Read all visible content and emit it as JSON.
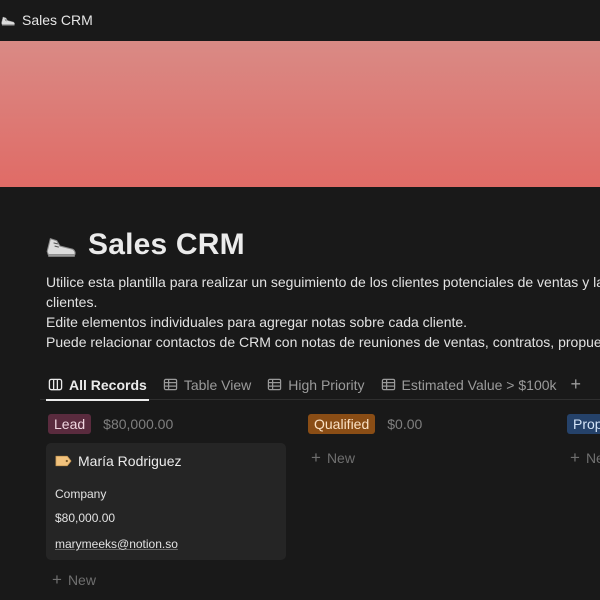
{
  "breadcrumb": {
    "title": "Sales CRM",
    "icon": "sneaker-icon"
  },
  "cover": {
    "color_top": "#d98a85",
    "color_bottom": "#e06b66"
  },
  "page": {
    "title": "Sales CRM",
    "icon": "sneaker-icon",
    "description": [
      "Utilice esta plantilla para realizar un seguimiento de los clientes potenciales de ventas y las ir",
      "clientes.",
      "Edite elementos individuales para agregar notas sobre cada cliente.",
      "Puede relacionar contactos de CRM con notas de reuniones de ventas, contratos, propuestas"
    ]
  },
  "tabs": [
    {
      "label": "All Records",
      "icon": "board-icon",
      "active": true
    },
    {
      "label": "Table View",
      "icon": "table-icon",
      "active": false
    },
    {
      "label": "High Priority",
      "icon": "table-icon",
      "active": false
    },
    {
      "label": "Estimated Value > $100k",
      "icon": "table-icon",
      "active": false
    }
  ],
  "add_view_symbol": "+",
  "columns": [
    {
      "tag": "Lead",
      "sum": "$80,000.00",
      "tag_color": "#5a2b3e"
    },
    {
      "tag": "Qualified",
      "sum": "$0.00",
      "tag_color": "#8a4d15"
    },
    {
      "tag": "Prop",
      "sum": "",
      "tag_color": "#25426a"
    }
  ],
  "card": {
    "icon": "price-tag-icon",
    "name": "María Rodriguez",
    "company": "Company",
    "value": "$80,000.00",
    "email": "marymeeks@notion.so"
  },
  "new_label": "New",
  "new_label_truncated": "Ne"
}
